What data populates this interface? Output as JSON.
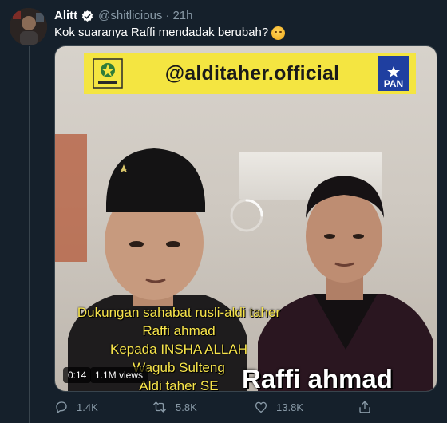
{
  "tweet": {
    "display_name": "Alitt",
    "handle": "@shitlicious",
    "separator": "·",
    "time": "21h",
    "text": "Kok suaranya Raffi mendadak berubah?",
    "emoji": "smiling-face-with-hand-over-mouth",
    "verified": true
  },
  "media": {
    "banner_text": "@alditaher.official",
    "right_logo_text": "PAN",
    "caption_lines": [
      "Dukungan sahabat rusli-aldi taher",
      "Raffi ahmad",
      "Kepada INSHA ALLAH",
      "Wagub Sulteng",
      "Aldi taher SE"
    ],
    "name_overlay": "Raffi ahmad",
    "video_time": "0:14",
    "views": "1.1M views",
    "banner_color": "#f4e541",
    "caption_color": "#f7e44b"
  },
  "actions": {
    "replies": "1.4K",
    "retweets": "5.8K",
    "likes": "13.8K",
    "icons": [
      "reply-icon",
      "retweet-icon",
      "like-icon",
      "share-icon"
    ]
  },
  "colors": {
    "background": "#15202b",
    "secondary_text": "#8899a6",
    "border": "#38444d",
    "verified": "#ffffff"
  }
}
